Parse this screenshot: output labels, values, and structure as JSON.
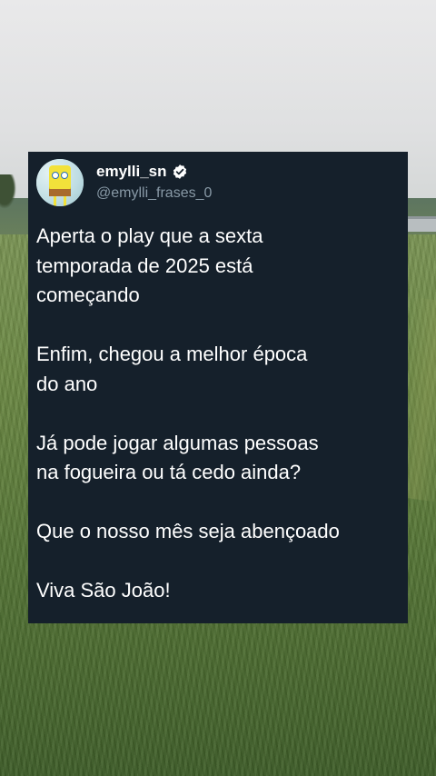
{
  "post": {
    "display_name": "emylli_sn",
    "handle": "@emylli_frases_0",
    "verified": true,
    "avatar": "spongebob-avatar",
    "paragraphs": [
      "Aperta o play que a sexta\ntemporada de 2025 está\ncomeçando",
      "Enfim, chegou a melhor época\ndo ano",
      "Já pode jogar algumas pessoas\nna fogueira ou tá cedo ainda?",
      "Que o nosso mês seja abençoado",
      "Viva São João!"
    ]
  },
  "colors": {
    "card_background": "#15202b",
    "text": "#ffffff",
    "handle": "#8899a6",
    "verified_badge": "#ffffff"
  }
}
